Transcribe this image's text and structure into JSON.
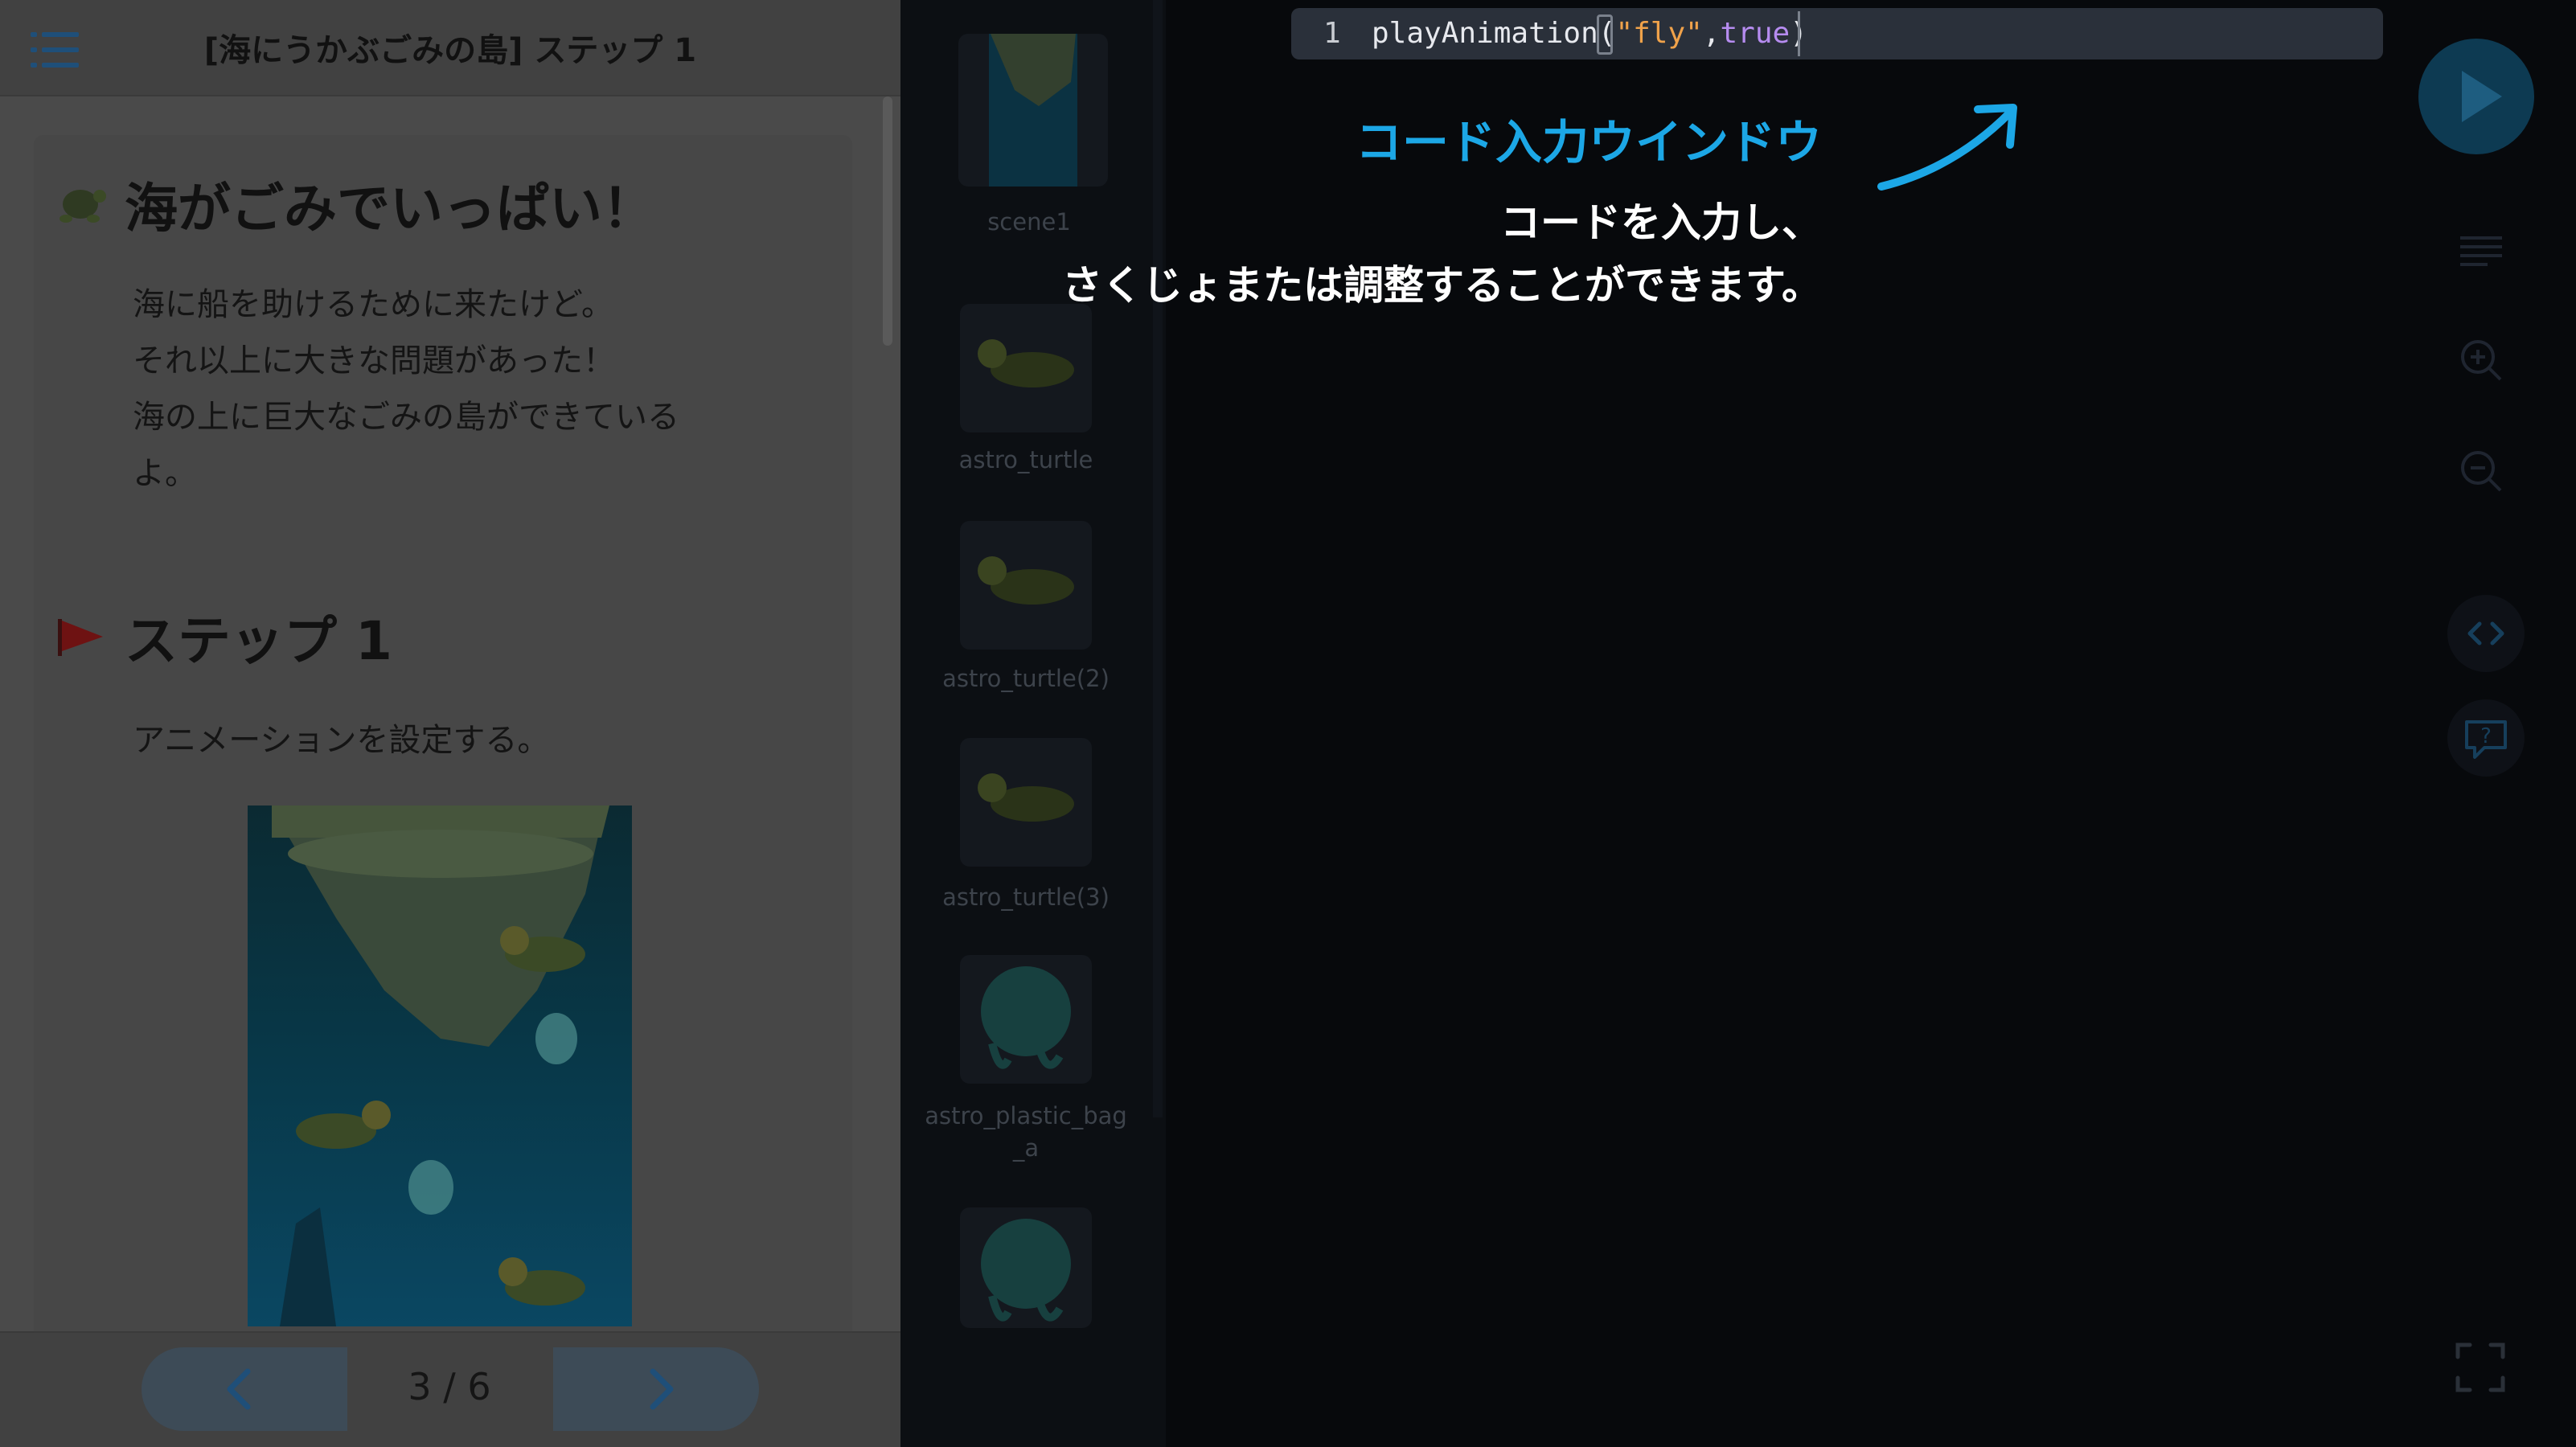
{
  "lesson": {
    "title": "[海にうかぶごみの島] ステップ 1",
    "heading": "海がごみでいっぱい！",
    "intro_lines": [
      "海に船を助けるために来たけど。",
      "それ以上に大きな問題があった！",
      "海の上に巨大なごみの島ができている",
      "よ。"
    ],
    "step_heading": "ステップ 1",
    "step_text": "アニメーションを設定する。",
    "page_counter": "3 / 6"
  },
  "sprites": [
    {
      "label": "scene1",
      "icon": "scene-thumbnail-icon"
    },
    {
      "label": "astro_turtle",
      "icon": "turtle-sprite-icon"
    },
    {
      "label": "astro_turtle(2)",
      "icon": "turtle-sprite-icon"
    },
    {
      "label": "astro_turtle(3)",
      "icon": "turtle-sprite-icon"
    },
    {
      "label": "astro_plastic_bag_a",
      "icon": "plastic-bag-sprite-icon"
    },
    {
      "label": "",
      "icon": "plastic-bag-sprite-icon"
    }
  ],
  "editor": {
    "line_number": "1",
    "code_fn": "playAnimation(",
    "code_str": "\"fly\"",
    "code_comma": ",",
    "code_kw": "true",
    "code_close": ")"
  },
  "overlay": {
    "title": "コード入力ウインドウ",
    "desc_line1": "コードを入力し、",
    "desc_line2": "さくじょまたは調整することができます。"
  },
  "toolbar": {
    "icons": [
      "play-icon",
      "list-icon",
      "zoom-in-icon",
      "zoom-out-icon",
      "code-icon",
      "help-chat-icon",
      "fullscreen-icon"
    ]
  },
  "colors": {
    "accent": "#1ca7e6",
    "string": "#f0a24a",
    "keyword": "#b68cf0"
  }
}
